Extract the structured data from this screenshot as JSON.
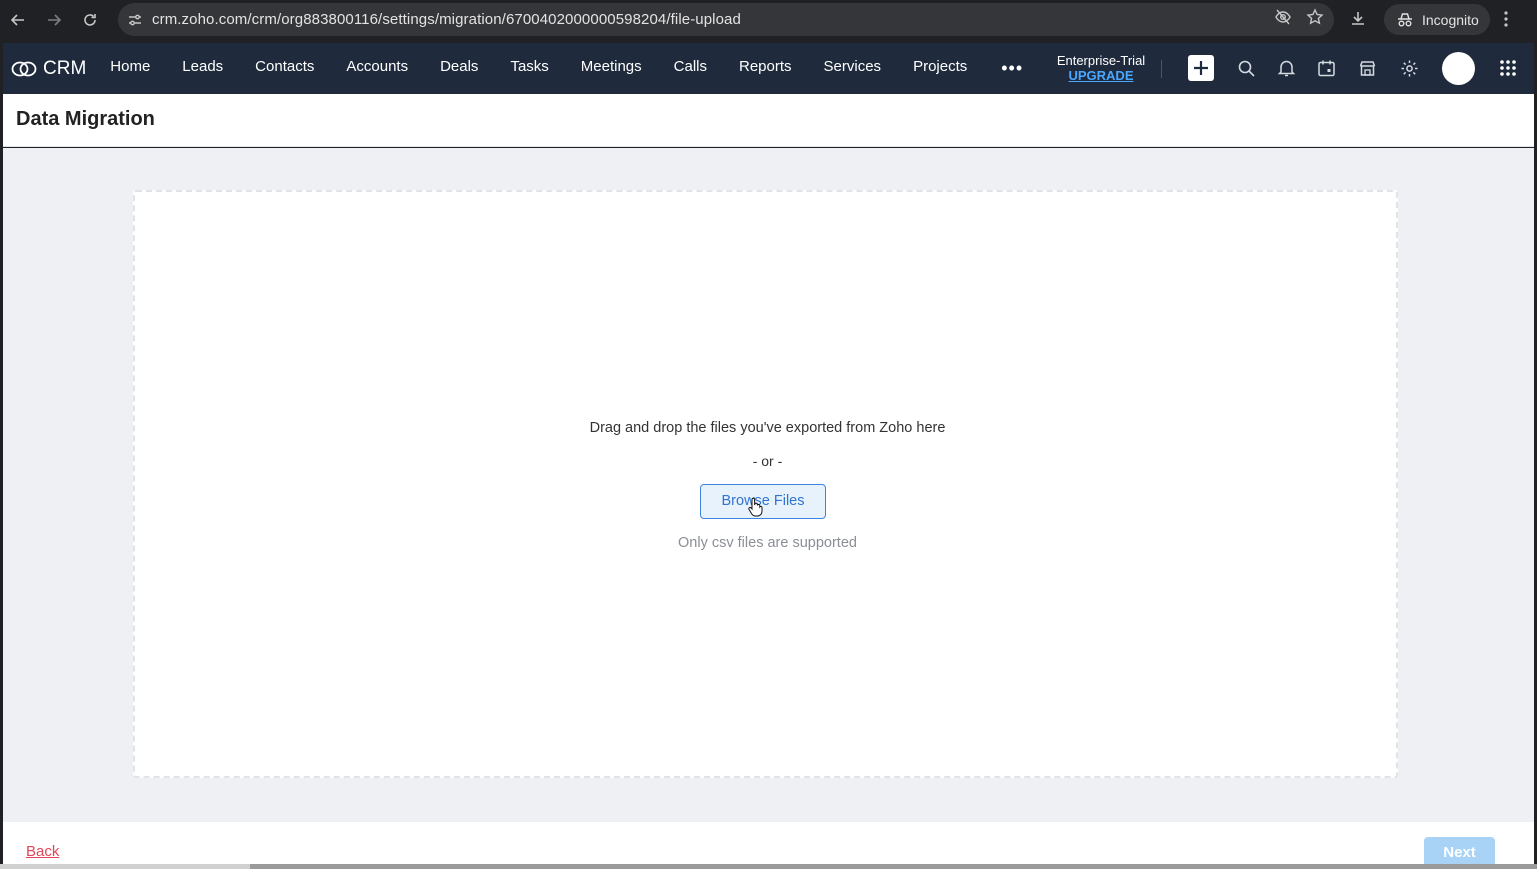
{
  "browser": {
    "url": "crm.zoho.com/crm/org883800116/settings/migration/6700402000000598204/file-upload",
    "profile_label": "Incognito"
  },
  "app": {
    "logo_text": "CRM",
    "nav": [
      "Home",
      "Leads",
      "Contacts",
      "Accounts",
      "Deals",
      "Tasks",
      "Meetings",
      "Calls",
      "Reports",
      "Services",
      "Projects"
    ],
    "more": "•••",
    "edition": "Enterprise-Trial",
    "upgrade_label": "UPGRADE"
  },
  "page": {
    "title": "Data Migration"
  },
  "upload": {
    "message": "Drag and drop the files you've exported from Zoho here",
    "separator": "- or -",
    "browse_label": "Browse Files",
    "hint": "Only csv files are supported"
  },
  "footer": {
    "back_label": "Back",
    "next_label": "Next"
  },
  "colors": {
    "nav_bg": "#1f2b3d",
    "accent": "#2f74d0",
    "back_link": "#e0475a",
    "next_disabled": "#a9d2f7"
  }
}
